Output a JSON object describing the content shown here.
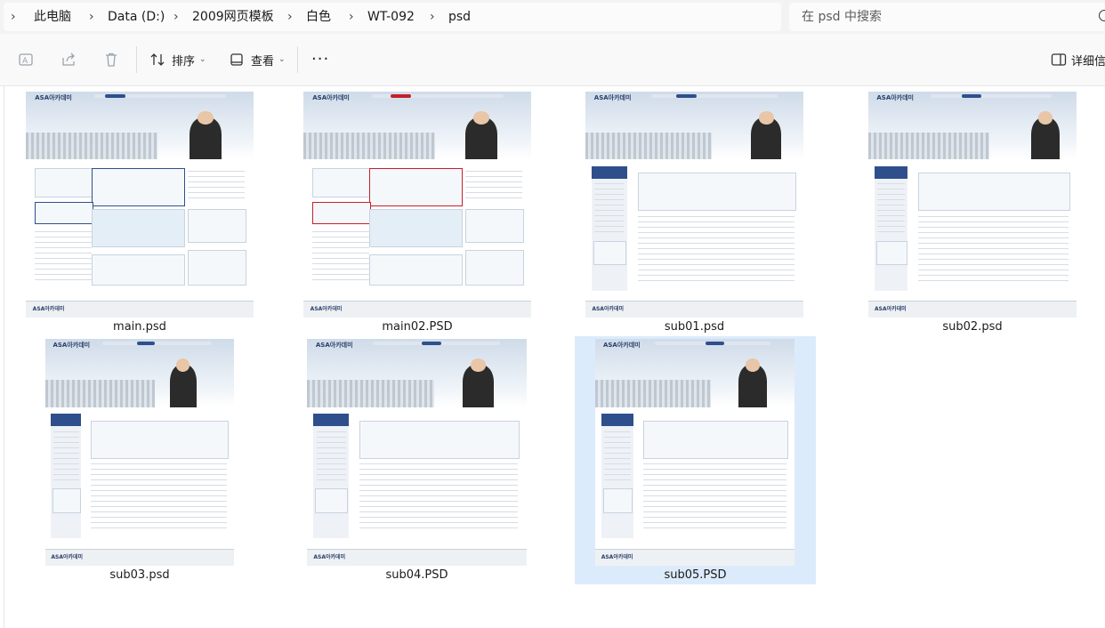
{
  "breadcrumb": [
    "此电脑",
    "Data (D:)",
    "2009网页模板",
    "白色",
    "WT-092",
    "psd"
  ],
  "search": {
    "placeholder": "在 psd 中搜索"
  },
  "toolbar": {
    "sort_label": "排序",
    "view_label": "查看",
    "more_label": "···",
    "details_label": "详细信"
  },
  "thumb_logo": "ASA아카데미",
  "files": [
    {
      "name": "main.psd",
      "accent": "#2e4f8c",
      "selected": false
    },
    {
      "name": "main02.PSD",
      "accent": "#c4202a",
      "selected": false
    },
    {
      "name": "sub01.psd",
      "accent": "#2e4f8c",
      "selected": false
    },
    {
      "name": "sub02.psd",
      "accent": "#2e4f8c",
      "selected": false
    },
    {
      "name": "sub03.psd",
      "accent": "#2e4f8c",
      "selected": false
    },
    {
      "name": "sub04.PSD",
      "accent": "#2e4f8c",
      "selected": false
    },
    {
      "name": "sub05.PSD",
      "accent": "#2e4f8c",
      "selected": true
    }
  ],
  "colors": {
    "selection": "#dcebfb",
    "toolbar_bg": "#f9f9f9",
    "address_bg": "#f3f3f3"
  }
}
